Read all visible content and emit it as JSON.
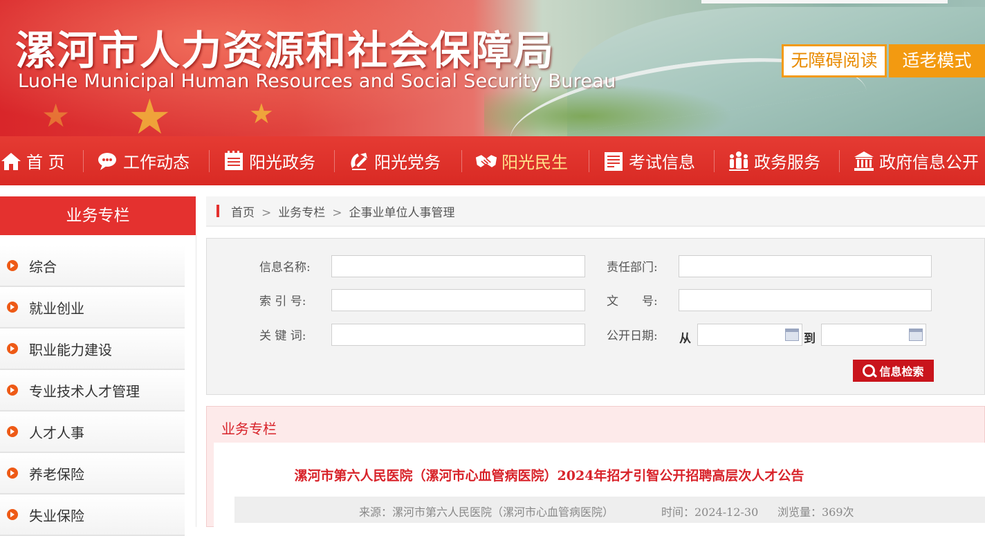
{
  "header": {
    "title": "漯河市人力资源和社会保障局",
    "subtitle": "LuoHe Municipal Human Resources and Social Security Bureau",
    "accessibility_label": "无障碍阅读",
    "elder_mode_label": "适老模式"
  },
  "nav": {
    "items": [
      {
        "label": "首 页",
        "icon": "home-icon"
      },
      {
        "label": "工作动态",
        "icon": "chat-bubble-icon"
      },
      {
        "label": "阳光政务",
        "icon": "document-list-icon"
      },
      {
        "label": "阳光党务",
        "icon": "party-emblem-icon"
      },
      {
        "label": "阳光民生",
        "icon": "handshake-icon",
        "active": true
      },
      {
        "label": "考试信息",
        "icon": "exam-sheet-icon"
      },
      {
        "label": "政务服务",
        "icon": "people-icon"
      },
      {
        "label": "政府信息公开",
        "icon": "government-building-icon"
      }
    ]
  },
  "sidebar": {
    "title": "业务专栏",
    "items": [
      {
        "label": "综合"
      },
      {
        "label": "就业创业"
      },
      {
        "label": "职业能力建设"
      },
      {
        "label": "专业技术人才管理"
      },
      {
        "label": "人才人事"
      },
      {
        "label": "养老保险"
      },
      {
        "label": "失业保险"
      }
    ]
  },
  "breadcrumb": {
    "items": [
      "首页",
      "业务专栏",
      "企事业单位人事管理"
    ],
    "separator": ">"
  },
  "search": {
    "info_name_label": "信息名称:",
    "department_label": "责任部门:",
    "index_label": "索 引 号:",
    "doc_number_label": "文　　号:",
    "keyword_label": "关 键 词:",
    "publish_date_label": "公开日期:",
    "date_from_label": "从",
    "date_to_label": "到",
    "button_label": "信息检索"
  },
  "content": {
    "section_title": "业务专栏",
    "article": {
      "title": "漯河市第六人民医院（漯河市心血管病医院）2024年招才引智公开招聘高层次人才公告",
      "source": "来源：漯河市第六人民医院（漯河市心血管病医院）",
      "time": "时间：2024-12-30",
      "views": "浏览量：369次"
    }
  },
  "colors": {
    "primary_red": "#e4312f",
    "accent_orange": "#f39a10",
    "active_nav": "#ffe28a",
    "title_red": "#d8232a"
  }
}
